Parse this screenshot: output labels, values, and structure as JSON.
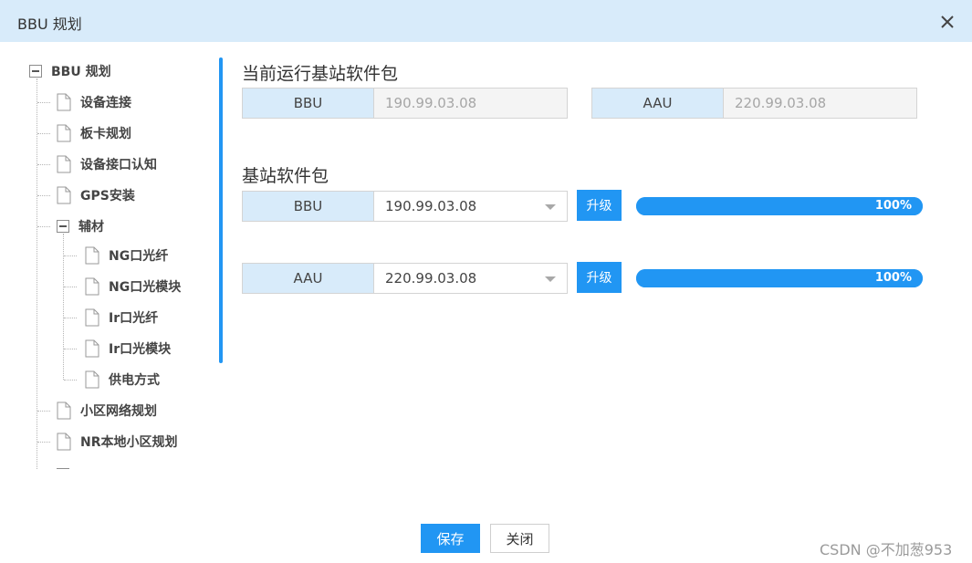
{
  "window": {
    "title": "BBU 规划",
    "close_icon": "close-icon"
  },
  "tree": {
    "root": "BBU 规划",
    "items": [
      {
        "label": "设备连接"
      },
      {
        "label": "板卡规划"
      },
      {
        "label": "设备接口认知"
      },
      {
        "label": "GPS安装"
      }
    ],
    "group": {
      "label": "辅材",
      "children": [
        {
          "label": "NG口光纤"
        },
        {
          "label": "NG口光模块"
        },
        {
          "label": "Ir口光纤"
        },
        {
          "label": "Ir口光模块"
        },
        {
          "label": "供电方式"
        }
      ]
    },
    "after": [
      {
        "label": "小区网络规划"
      },
      {
        "label": "NR本地小区规划"
      }
    ]
  },
  "current": {
    "title": "当前运行基站软件包",
    "bbu": {
      "label": "BBU",
      "value": "190.99.03.08"
    },
    "aau": {
      "label": "AAU",
      "value": "220.99.03.08"
    }
  },
  "package": {
    "title": "基站软件包",
    "rows": [
      {
        "label": "BBU",
        "value": "190.99.03.08",
        "button": "升级",
        "progress": 100,
        "progress_text": "100%"
      },
      {
        "label": "AAU",
        "value": "220.99.03.08",
        "button": "升级",
        "progress": 100,
        "progress_text": "100%"
      }
    ]
  },
  "footer": {
    "save": "保存",
    "close": "关闭"
  },
  "watermark": "CSDN @不加葱953",
  "colors": {
    "accent": "#2196f3",
    "header_bg": "#d8ebfa"
  }
}
